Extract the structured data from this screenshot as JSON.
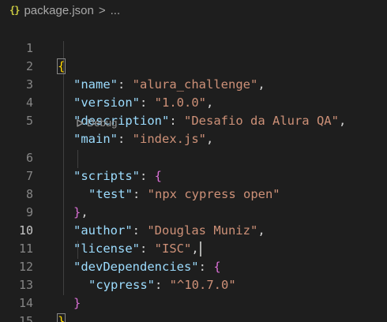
{
  "breadcrumb": {
    "icon_text": "{}",
    "file": "package.json",
    "separator": ">",
    "more": "..."
  },
  "editor": {
    "line_numbers": [
      "1",
      "2",
      "3",
      "4",
      "5",
      "6",
      "7",
      "8",
      "9",
      "10",
      "11",
      "12",
      "13",
      "14",
      "15"
    ],
    "active_line": "10",
    "codelens_label": "Debug",
    "codelens_icon": "play-triangle",
    "colors": {
      "key": "#9cdcfe",
      "string": "#ce9178",
      "bracket_level1": "#ffd700",
      "bracket_level2": "#da70d6",
      "background": "#1e1e1e"
    },
    "lines": {
      "l1": {
        "open": "{"
      },
      "l2": {
        "key": "\"name\"",
        "colon": ": ",
        "value": "\"alura_challenge\"",
        "comma": ","
      },
      "l3": {
        "key": "\"version\"",
        "colon": ": ",
        "value": "\"1.0.0\"",
        "comma": ","
      },
      "l4": {
        "key": "\"description\"",
        "colon": ": ",
        "value": "\"Desafio da Alura QA\"",
        "comma": ","
      },
      "l5": {
        "key": "\"main\"",
        "colon": ": ",
        "value": "\"index.js\"",
        "comma": ","
      },
      "l6": {
        "key": "\"scripts\"",
        "colon": ": ",
        "open": "{"
      },
      "l7": {
        "key": "\"test\"",
        "colon": ": ",
        "value": "\"npx cypress open\""
      },
      "l8": {
        "close": "}",
        "comma": ","
      },
      "l9": {
        "key": "\"author\"",
        "colon": ": ",
        "value": "\"Douglas Muniz\"",
        "comma": ","
      },
      "l10": {
        "key": "\"license\"",
        "colon": ": ",
        "value": "\"ISC\"",
        "comma": ","
      },
      "l11": {
        "key": "\"devDependencies\"",
        "colon": ": ",
        "open": "{"
      },
      "l12": {
        "key": "\"cypress\"",
        "colon": ": ",
        "value": "\"^10.7.0\""
      },
      "l13": {
        "close": "}"
      },
      "l14": {
        "close": "}"
      }
    }
  }
}
